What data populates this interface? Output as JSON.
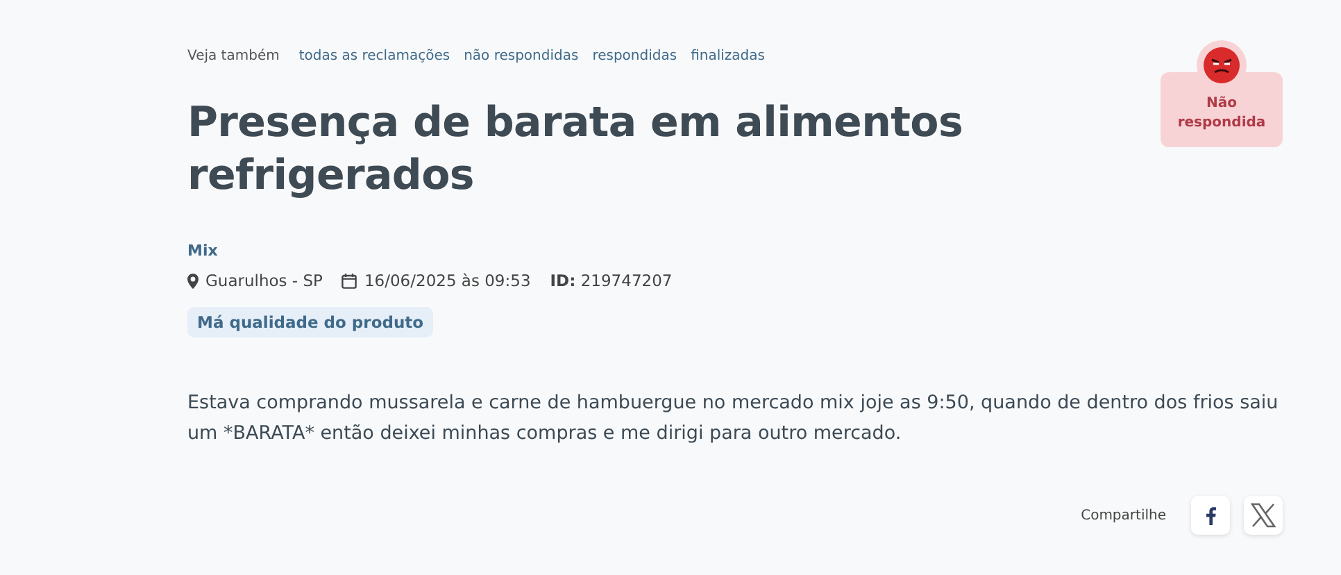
{
  "see_also": {
    "label": "Veja também",
    "links": [
      "todas as reclamações",
      "não respondidas",
      "respondidas",
      "finalizadas"
    ]
  },
  "status_badge": {
    "label": "Não respondida"
  },
  "title": "Presença de barata em alimentos refrigerados",
  "company": "Mix",
  "meta": {
    "location": "Guarulhos - SP",
    "date": "16/06/2025 às 09:53",
    "id": "**ID:** 219747207"
  },
  "category_tag": "Má qualidade do produto",
  "description": "Estava comprando mussarela e carne de hambuergue no mercado mix joje as 9:50, quando de dentro dos frios saiu um *BARATA* então deixei minhas compras e me dirigi para outro mercado.",
  "share": {
    "label": "Compartilhe",
    "buttons": [
      {
        "kind": "facebook"
      },
      {
        "kind": "x"
      }
    ]
  }
}
